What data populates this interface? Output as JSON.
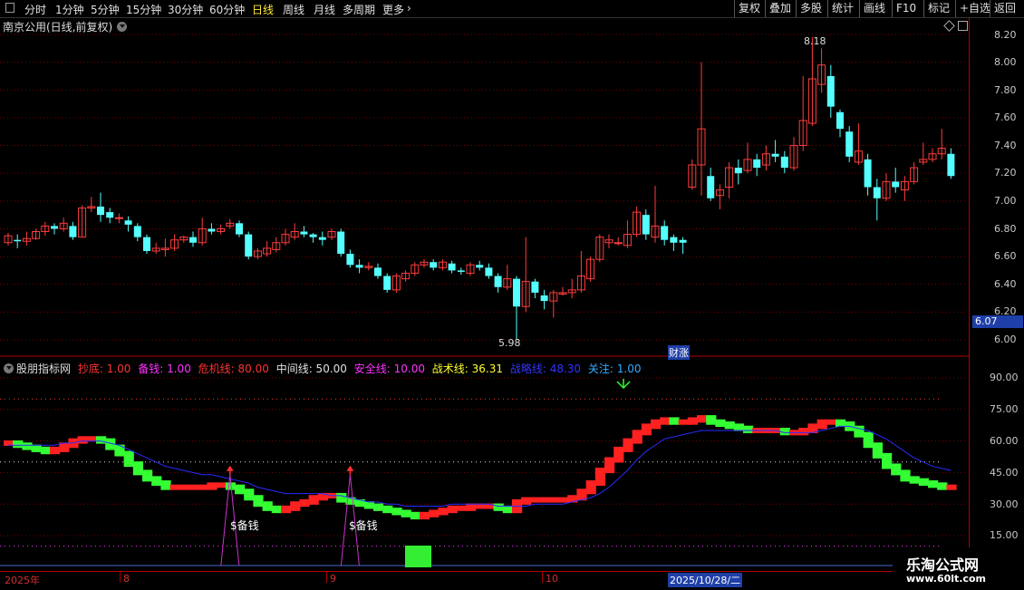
{
  "toolbar": {
    "periods": [
      "分时",
      "1分钟",
      "5分钟",
      "15分钟",
      "30分钟",
      "60分钟",
      "日线",
      "周线",
      "月线",
      "多周期",
      "更多"
    ],
    "active": "日线",
    "right_buttons": [
      "复权",
      "叠加",
      "多股",
      "统计",
      "画线",
      "F10",
      "标记",
      "+自选",
      "返回"
    ]
  },
  "stock": {
    "title": "南京公用(日线,前复权)"
  },
  "price_axis": {
    "labels": [
      "8.20",
      "8.00",
      "7.80",
      "7.60",
      "7.40",
      "7.20",
      "7.00",
      "6.80",
      "6.60",
      "6.40",
      "6.20",
      "6.00"
    ],
    "current": "6.07"
  },
  "annotations": {
    "high": "8.18",
    "low": "5.98",
    "event_tag": "财涨"
  },
  "indicator": {
    "name": "股朋指标网",
    "items": [
      {
        "label": "抄底: 1.00",
        "color": "#ff3333"
      },
      {
        "label": "备钱: 1.00",
        "color": "#ff33ff"
      },
      {
        "label": "危机线: 80.00",
        "color": "#ff3333"
      },
      {
        "label": "中间线: 50.00",
        "color": "#e0e0e0"
      },
      {
        "label": "安全线: 10.00",
        "color": "#ff33ff"
      },
      {
        "label": "战术线: 36.31",
        "color": "#ffff33"
      },
      {
        "label": "战略线: 48.30",
        "color": "#3333ff"
      },
      {
        "label": "关注: 1.00",
        "color": "#33aaff"
      }
    ],
    "axis_labels": [
      "90.00",
      "75.00",
      "60.00",
      "45.00",
      "30.00",
      "15.00"
    ],
    "signal_label": "$备钱"
  },
  "date_axis": {
    "labels": [
      "2025年",
      "8",
      "9",
      "10"
    ],
    "selected": "2025/10/28/二"
  },
  "watermark": {
    "line1": "乐淘公式网",
    "line2": "www.60lt.com"
  },
  "colors": {
    "up": "#ff3d3d",
    "down": "#54ffff",
    "tactic_up": "#ff2020",
    "tactic_down": "#33ff33",
    "strategy": "#2a2aff"
  },
  "chart_data": {
    "type": "candlestick",
    "ylim": [
      5.9,
      8.3
    ],
    "candles": [
      [
        6.7,
        6.75,
        6.68,
        6.77
      ],
      [
        6.72,
        6.71,
        6.66,
        6.76
      ],
      [
        6.71,
        6.73,
        6.68,
        6.78
      ],
      [
        6.73,
        6.78,
        6.72,
        6.8
      ],
      [
        6.78,
        6.82,
        6.75,
        6.85
      ],
      [
        6.82,
        6.8,
        6.76,
        6.84
      ],
      [
        6.8,
        6.84,
        6.78,
        6.88
      ],
      [
        6.82,
        6.74,
        6.72,
        6.85
      ],
      [
        6.74,
        6.95,
        6.74,
        6.97
      ],
      [
        6.95,
        6.96,
        6.92,
        7.03
      ],
      [
        6.96,
        6.9,
        6.85,
        7.06
      ],
      [
        6.92,
        6.88,
        6.84,
        6.95
      ],
      [
        6.88,
        6.88,
        6.84,
        6.91
      ],
      [
        6.86,
        6.83,
        6.78,
        6.89
      ],
      [
        6.82,
        6.74,
        6.71,
        6.84
      ],
      [
        6.74,
        6.64,
        6.62,
        6.76
      ],
      [
        6.64,
        6.66,
        6.62,
        6.7
      ],
      [
        6.65,
        6.66,
        6.6,
        6.73
      ],
      [
        6.66,
        6.72,
        6.64,
        6.76
      ],
      [
        6.72,
        6.74,
        6.7,
        6.75
      ],
      [
        6.74,
        6.7,
        6.67,
        6.78
      ],
      [
        6.7,
        6.8,
        6.68,
        6.88
      ],
      [
        6.8,
        6.78,
        6.76,
        6.84
      ],
      [
        6.78,
        6.8,
        6.76,
        6.83
      ],
      [
        6.82,
        6.84,
        6.8,
        6.87
      ],
      [
        6.84,
        6.76,
        6.74,
        6.86
      ],
      [
        6.76,
        6.6,
        6.58,
        6.78
      ],
      [
        6.6,
        6.64,
        6.58,
        6.66
      ],
      [
        6.62,
        6.66,
        6.6,
        6.71
      ],
      [
        6.65,
        6.7,
        6.63,
        6.74
      ],
      [
        6.7,
        6.76,
        6.68,
        6.8
      ],
      [
        6.74,
        6.78,
        6.72,
        6.84
      ],
      [
        6.78,
        6.76,
        6.74,
        6.82
      ],
      [
        6.76,
        6.74,
        6.7,
        6.77
      ],
      [
        6.74,
        6.72,
        6.68,
        6.78
      ],
      [
        6.74,
        6.78,
        6.72,
        6.8
      ],
      [
        6.78,
        6.62,
        6.6,
        6.8
      ],
      [
        6.62,
        6.54,
        6.52,
        6.65
      ],
      [
        6.54,
        6.52,
        6.48,
        6.58
      ],
      [
        6.52,
        6.53,
        6.5,
        6.56
      ],
      [
        6.52,
        6.46,
        6.44,
        6.55
      ],
      [
        6.46,
        6.36,
        6.34,
        6.48
      ],
      [
        6.36,
        6.46,
        6.34,
        6.48
      ],
      [
        6.44,
        6.48,
        6.42,
        6.5
      ],
      [
        6.48,
        6.54,
        6.46,
        6.56
      ],
      [
        6.54,
        6.56,
        6.52,
        6.58
      ],
      [
        6.56,
        6.52,
        6.5,
        6.58
      ],
      [
        6.52,
        6.56,
        6.5,
        6.58
      ],
      [
        6.55,
        6.5,
        6.48,
        6.57
      ],
      [
        6.5,
        6.49,
        6.47,
        6.52
      ],
      [
        6.48,
        6.54,
        6.46,
        6.56
      ],
      [
        6.54,
        6.52,
        6.5,
        6.57
      ],
      [
        6.52,
        6.46,
        6.44,
        6.55
      ],
      [
        6.46,
        6.38,
        6.34,
        6.48
      ],
      [
        6.38,
        6.44,
        6.36,
        6.54
      ],
      [
        6.44,
        6.24,
        6.0,
        6.46
      ],
      [
        6.24,
        6.42,
        6.2,
        6.74
      ],
      [
        6.42,
        6.34,
        6.3,
        6.44
      ],
      [
        6.32,
        6.28,
        6.22,
        6.36
      ],
      [
        6.28,
        6.34,
        6.16,
        6.36
      ],
      [
        6.33,
        6.34,
        6.32,
        6.38
      ],
      [
        6.34,
        6.36,
        6.3,
        6.44
      ],
      [
        6.36,
        6.46,
        6.34,
        6.64
      ],
      [
        6.44,
        6.58,
        6.42,
        6.6
      ],
      [
        6.58,
        6.74,
        6.56,
        6.76
      ],
      [
        6.7,
        6.72,
        6.66,
        6.76
      ],
      [
        6.7,
        6.7,
        6.68,
        6.74
      ],
      [
        6.68,
        6.76,
        6.66,
        6.86
      ],
      [
        6.76,
        6.92,
        6.74,
        6.96
      ],
      [
        6.9,
        6.76,
        6.72,
        6.94
      ],
      [
        6.74,
        6.82,
        6.7,
        7.11
      ],
      [
        6.82,
        6.72,
        6.68,
        6.86
      ],
      [
        6.74,
        6.7,
        6.64,
        6.76
      ],
      [
        6.72,
        6.7,
        6.62,
        6.74
      ],
      [
        7.1,
        7.26,
        7.08,
        7.3
      ],
      [
        7.26,
        7.52,
        7.04,
        8.0
      ],
      [
        7.18,
        7.02,
        7.0,
        7.24
      ],
      [
        7.04,
        7.08,
        6.94,
        7.12
      ],
      [
        7.1,
        7.24,
        7.02,
        7.28
      ],
      [
        7.24,
        7.2,
        7.12,
        7.3
      ],
      [
        7.22,
        7.3,
        7.2,
        7.42
      ],
      [
        7.3,
        7.24,
        7.18,
        7.34
      ],
      [
        7.26,
        7.34,
        7.22,
        7.4
      ],
      [
        7.34,
        7.32,
        7.28,
        7.44
      ],
      [
        7.32,
        7.24,
        7.2,
        7.36
      ],
      [
        7.24,
        7.4,
        7.22,
        7.46
      ],
      [
        7.4,
        7.58,
        7.36,
        7.9
      ],
      [
        7.56,
        7.88,
        7.54,
        8.18
      ],
      [
        7.84,
        7.98,
        7.78,
        8.1
      ],
      [
        7.9,
        7.68,
        7.6,
        7.98
      ],
      [
        7.64,
        7.52,
        7.46,
        7.66
      ],
      [
        7.5,
        7.32,
        7.28,
        7.54
      ],
      [
        7.28,
        7.36,
        7.26,
        7.56
      ],
      [
        7.3,
        7.1,
        7.04,
        7.34
      ],
      [
        7.1,
        7.02,
        6.86,
        7.16
      ],
      [
        7.02,
        7.14,
        7.0,
        7.2
      ],
      [
        7.14,
        7.1,
        7.06,
        7.24
      ],
      [
        7.08,
        7.14,
        7.0,
        7.18
      ],
      [
        7.14,
        7.24,
        7.12,
        7.28
      ],
      [
        7.28,
        7.3,
        7.26,
        7.42
      ],
      [
        7.3,
        7.34,
        7.28,
        7.38
      ],
      [
        7.34,
        7.38,
        7.3,
        7.52
      ],
      [
        7.34,
        7.18,
        7.16,
        7.38
      ]
    ],
    "tactic_line": [
      59,
      58,
      57,
      56,
      55,
      56,
      58,
      60,
      61,
      61,
      60,
      57,
      54,
      49,
      45,
      42,
      40,
      38,
      38,
      38,
      38,
      38,
      39,
      39,
      38,
      36,
      33,
      30,
      28,
      27,
      28,
      30,
      31,
      33,
      34,
      34,
      32,
      31,
      30,
      29,
      28,
      27,
      26,
      25,
      24,
      25,
      26,
      27,
      28,
      28,
      29,
      29,
      29,
      28,
      27,
      31,
      32,
      32,
      32,
      32,
      32,
      33,
      36,
      40,
      46,
      51,
      56,
      60,
      64,
      67,
      69,
      70,
      69,
      69,
      70,
      71,
      69,
      68,
      67,
      66,
      65,
      65,
      65,
      65,
      64,
      64,
      65,
      67,
      69,
      69,
      68,
      66,
      63,
      58,
      53,
      48,
      45,
      42,
      41,
      40,
      39,
      38,
      38
    ],
    "strategy_line": [
      58,
      58,
      58,
      58,
      58,
      58,
      59,
      59,
      60,
      60,
      60,
      59,
      58,
      56,
      54,
      52,
      50,
      48,
      47,
      46,
      45,
      44,
      44,
      43,
      42,
      41,
      40,
      38,
      37,
      36,
      35,
      35,
      35,
      35,
      35,
      34,
      34,
      33,
      32,
      31,
      31,
      30,
      30,
      29,
      29,
      29,
      29,
      29,
      30,
      30,
      30,
      30,
      30,
      29,
      29,
      29,
      29,
      30,
      30,
      30,
      30,
      31,
      32,
      33,
      35,
      38,
      42,
      46,
      51,
      55,
      58,
      61,
      62,
      63,
      64,
      65,
      65,
      65,
      65,
      65,
      65,
      65,
      65,
      65,
      64,
      64,
      64,
      64,
      65,
      66,
      67,
      67,
      66,
      65,
      63,
      61,
      58,
      55,
      52,
      50,
      48,
      47,
      46
    ],
    "signals": [
      {
        "bar": 24,
        "label": "$备钱"
      },
      {
        "bar": 37,
        "label": "$备钱"
      }
    ]
  }
}
